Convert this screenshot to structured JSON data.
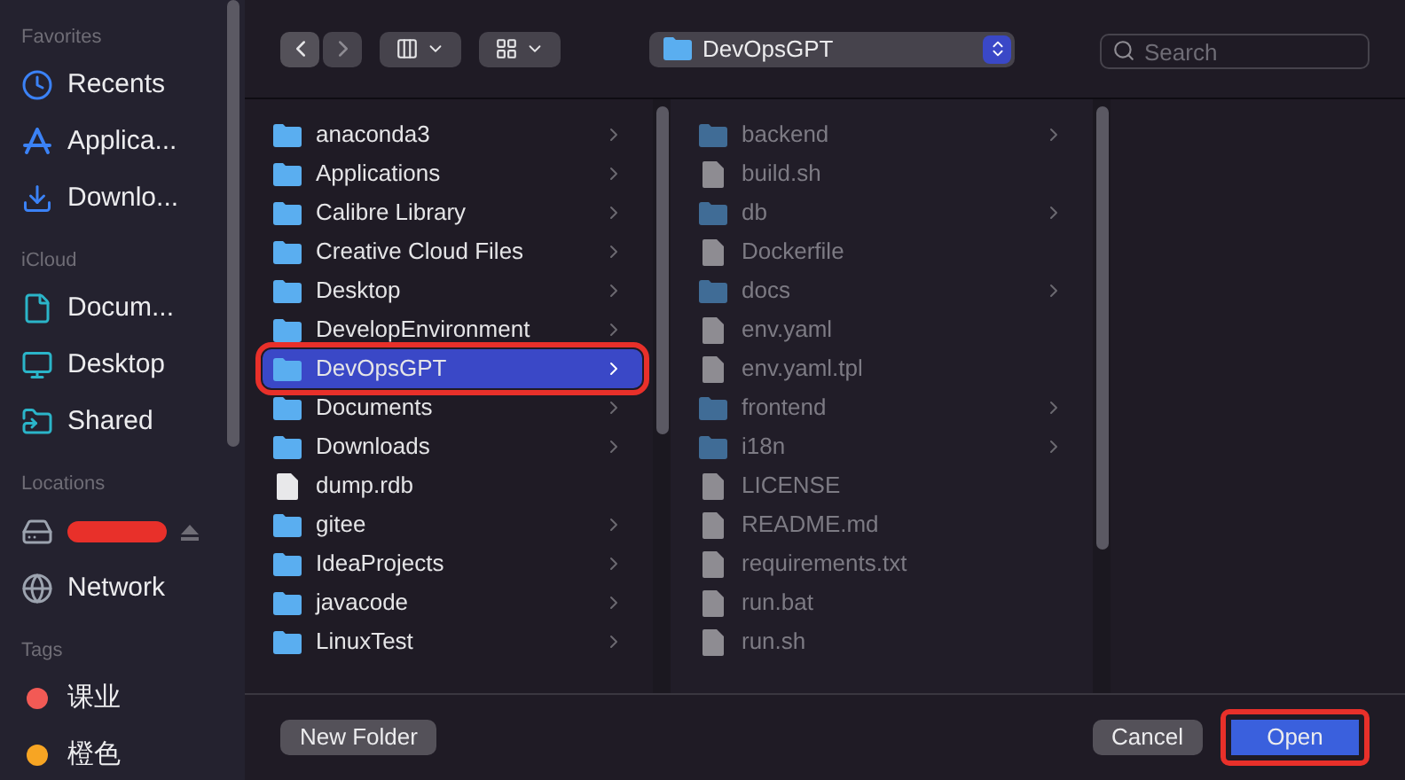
{
  "sidebar": {
    "sections": [
      {
        "title": "Favorites",
        "items": [
          {
            "label": "Recents",
            "kind": "clock"
          },
          {
            "label": "Applica...",
            "kind": "apps"
          },
          {
            "label": "Downlo...",
            "kind": "download"
          }
        ]
      },
      {
        "title": "iCloud",
        "items": [
          {
            "label": "Docum...",
            "kind": "doc"
          },
          {
            "label": "Desktop",
            "kind": "desktop"
          },
          {
            "label": "Shared",
            "kind": "shared"
          }
        ]
      },
      {
        "title": "Locations",
        "items": [
          {
            "kind": "drive",
            "redacted": true
          },
          {
            "label": "Network",
            "kind": "network"
          }
        ]
      },
      {
        "title": "Tags",
        "items": [
          {
            "label": "课业",
            "kind": "tag",
            "color": "#f25a55"
          },
          {
            "label": "橙色",
            "kind": "tag",
            "color": "#f7a523"
          }
        ]
      }
    ]
  },
  "toolbar": {
    "location": "DevOpsGPT",
    "search": {
      "placeholder": "Search"
    }
  },
  "columns": [
    {
      "active": true,
      "items": [
        {
          "name": "anaconda3",
          "kind": "folder",
          "selected": false,
          "annotated": false
        },
        {
          "name": "Applications",
          "kind": "folder",
          "selected": false,
          "annotated": false
        },
        {
          "name": "Calibre Library",
          "kind": "folder",
          "selected": false,
          "annotated": false
        },
        {
          "name": "Creative Cloud Files",
          "kind": "folder",
          "selected": false,
          "annotated": false
        },
        {
          "name": "Desktop",
          "kind": "folder",
          "selected": false,
          "annotated": false
        },
        {
          "name": "DevelopEnvironment",
          "kind": "folder",
          "selected": false,
          "annotated": false
        },
        {
          "name": "DevOpsGPT",
          "kind": "folder",
          "selected": true,
          "annotated": true
        },
        {
          "name": "Documents",
          "kind": "folder",
          "selected": false,
          "annotated": false
        },
        {
          "name": "Downloads",
          "kind": "folder",
          "selected": false,
          "annotated": false
        },
        {
          "name": "dump.rdb",
          "kind": "file",
          "selected": false,
          "annotated": false
        },
        {
          "name": "gitee",
          "kind": "folder",
          "selected": false,
          "annotated": false
        },
        {
          "name": "IdeaProjects",
          "kind": "folder",
          "selected": false,
          "annotated": false
        },
        {
          "name": "javacode",
          "kind": "folder",
          "selected": false,
          "annotated": false
        },
        {
          "name": "LinuxTest",
          "kind": "folder",
          "selected": false,
          "annotated": false
        }
      ]
    },
    {
      "active": false,
      "items": [
        {
          "name": "backend",
          "kind": "folder",
          "selected": false,
          "annotated": false
        },
        {
          "name": "build.sh",
          "kind": "file",
          "selected": false,
          "annotated": false
        },
        {
          "name": "db",
          "kind": "folder",
          "selected": false,
          "annotated": false
        },
        {
          "name": "Dockerfile",
          "kind": "file",
          "selected": false,
          "annotated": false
        },
        {
          "name": "docs",
          "kind": "folder",
          "selected": false,
          "annotated": false
        },
        {
          "name": "env.yaml",
          "kind": "file",
          "selected": false,
          "annotated": false
        },
        {
          "name": "env.yaml.tpl",
          "kind": "file",
          "selected": false,
          "annotated": false
        },
        {
          "name": "frontend",
          "kind": "folder",
          "selected": false,
          "annotated": false
        },
        {
          "name": "i18n",
          "kind": "folder",
          "selected": false,
          "annotated": false
        },
        {
          "name": "LICENSE",
          "kind": "file",
          "selected": false,
          "annotated": false
        },
        {
          "name": "README.md",
          "kind": "file",
          "selected": false,
          "annotated": false
        },
        {
          "name": "requirements.txt",
          "kind": "file",
          "selected": false,
          "annotated": false
        },
        {
          "name": "run.bat",
          "kind": "file",
          "selected": false,
          "annotated": false
        },
        {
          "name": "run.sh",
          "kind": "file",
          "selected": false,
          "annotated": false
        }
      ]
    }
  ],
  "footer": {
    "buttons": [
      {
        "label": "New Folder",
        "kind": "plain",
        "annotated": false
      },
      {
        "label": "Cancel",
        "kind": "plain",
        "annotated": false
      },
      {
        "label": "Open",
        "kind": "default",
        "annotated": true
      }
    ]
  }
}
